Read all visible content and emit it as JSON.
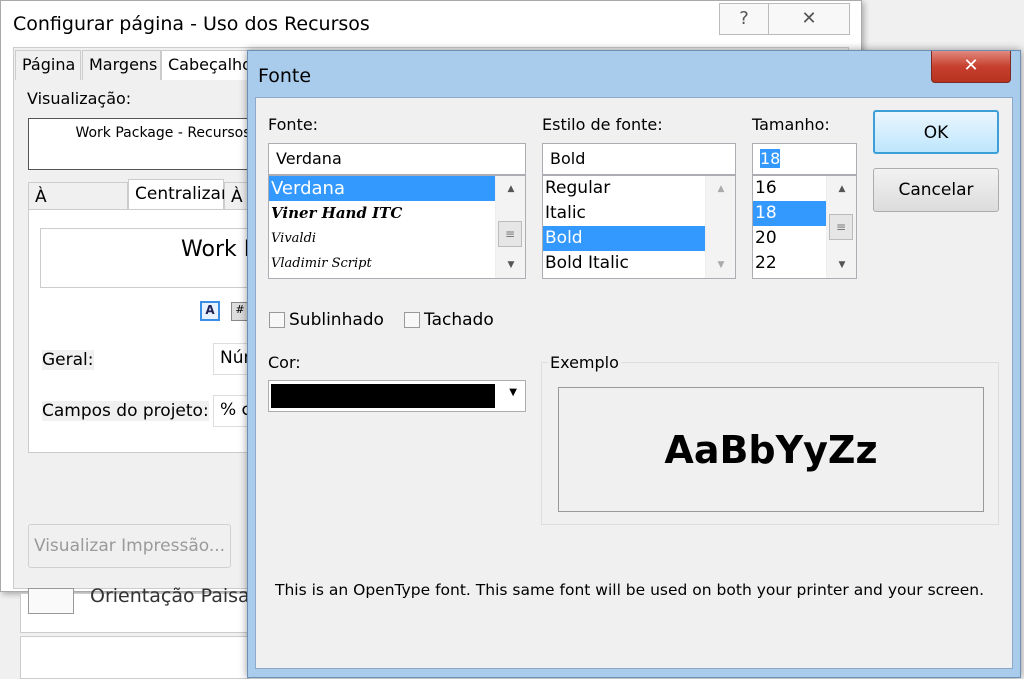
{
  "back_dialog": {
    "title": "Configurar página - Uso dos Recursos",
    "help_icon": "question-icon",
    "close_icon": "close-icon",
    "tabs": [
      "Página",
      "Margens",
      "Cabeçalho"
    ],
    "preview_label": "Visualização:",
    "preview_text": "Work Package - Recursos",
    "align_tabs": [
      "À esquerda",
      "Centralizar",
      "À d"
    ],
    "header_text": "Work P",
    "general_label": "Geral:",
    "general_value": "Núm",
    "fields_label": "Campos do projeto:",
    "fields_value": "% c",
    "print_preview_button": "Visualizar Impressão...",
    "behind_text": "Orientação Paisag"
  },
  "font_dialog": {
    "title": "Fonte",
    "font_label": "Fonte:",
    "font_value": "Verdana",
    "font_list": [
      "Verdana",
      "Viner Hand ITC",
      "Vivaldi",
      "Vladimir Script"
    ],
    "style_label": "Estilo de fonte:",
    "style_value": "Bold",
    "style_list": [
      "Regular",
      "Italic",
      "Bold",
      "Bold Italic"
    ],
    "size_label": "Tamanho:",
    "size_value": "18",
    "size_list": [
      "16",
      "18",
      "20",
      "22"
    ],
    "ok_button": "OK",
    "cancel_button": "Cancelar",
    "underline_label": "Sublinhado",
    "strikethrough_label": "Tachado",
    "color_label": "Cor:",
    "color_value": "#000000",
    "sample_label": "Exemplo",
    "sample_text": "AaBbYyZz",
    "info_text": "This is an OpenType font. This same font will be used on both your printer and your screen.",
    "selection_color": "#3399ff",
    "close_button_color": "#c7402f"
  }
}
